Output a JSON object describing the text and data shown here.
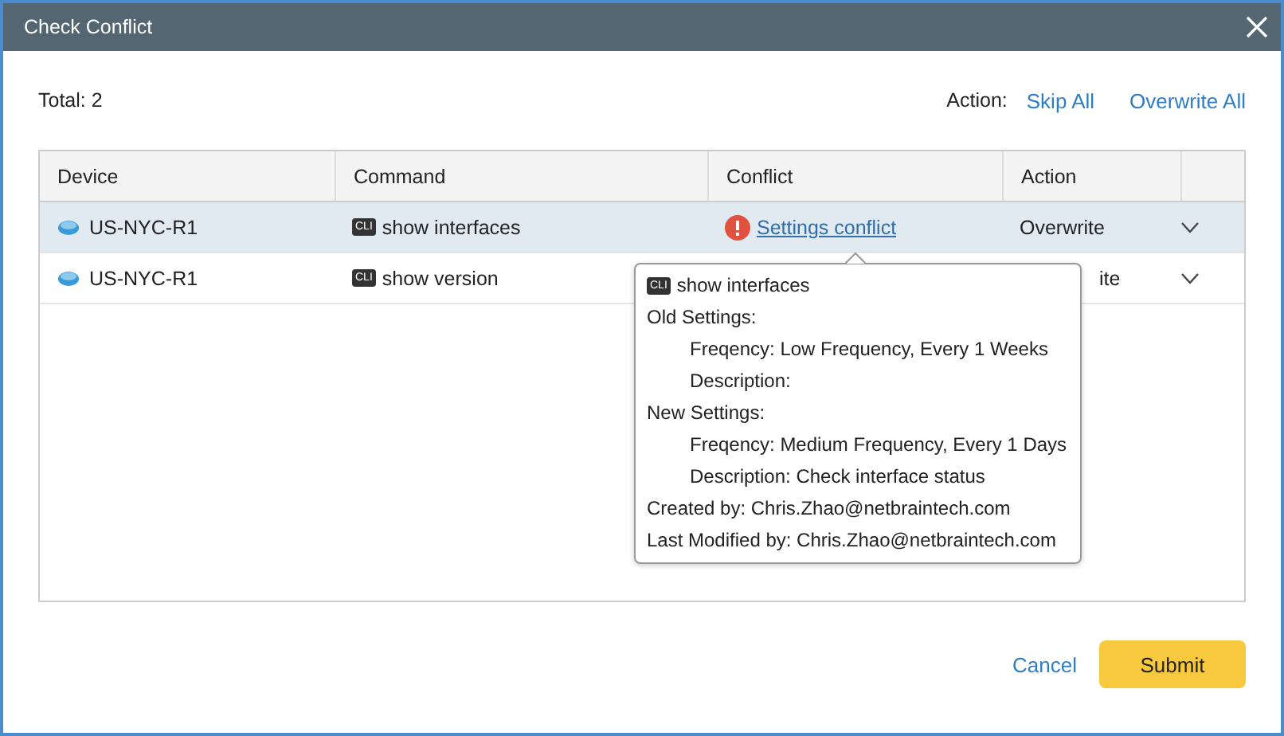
{
  "window": {
    "title": "Check Conflict"
  },
  "total": "Total: 2",
  "action_bar": {
    "label": "Action:",
    "links": [
      "Skip All",
      "Overwrite All"
    ]
  },
  "table": {
    "columns": [
      "Device",
      "Command",
      "Conflict",
      "Action"
    ],
    "rows": [
      {
        "device": "US-NYC-R1",
        "command_tag": "CLI",
        "command": "show interfaces",
        "conflict": "Settings conflict",
        "action": "Overwrite",
        "action_covered": false,
        "selected": true
      },
      {
        "device": "US-NYC-R1",
        "command_tag": "CLI",
        "command": "show version",
        "action": "ite",
        "action_covered": true,
        "selected": false
      }
    ]
  },
  "tooltip": {
    "command_tag": "CLI",
    "command": "show interfaces",
    "lines": [
      {
        "text": "Old Settings:",
        "children": [
          {
            "text": "Freqency: Low Frequency, Every 1 Weeks"
          },
          {
            "text": "Description:"
          }
        ]
      },
      {
        "text": "New Settings:",
        "children": [
          {
            "text": "Freqency: Medium Frequency, Every 1 Days"
          },
          {
            "text": "Description: Check interface status"
          }
        ]
      },
      {
        "text": "Created by: Chris.Zhao@netbraintech.com"
      },
      {
        "text": "Last Modified by: Chris.Zhao@netbraintech.com"
      }
    ]
  },
  "buttons": {
    "cancel": "Cancel",
    "submit": "Submit"
  }
}
